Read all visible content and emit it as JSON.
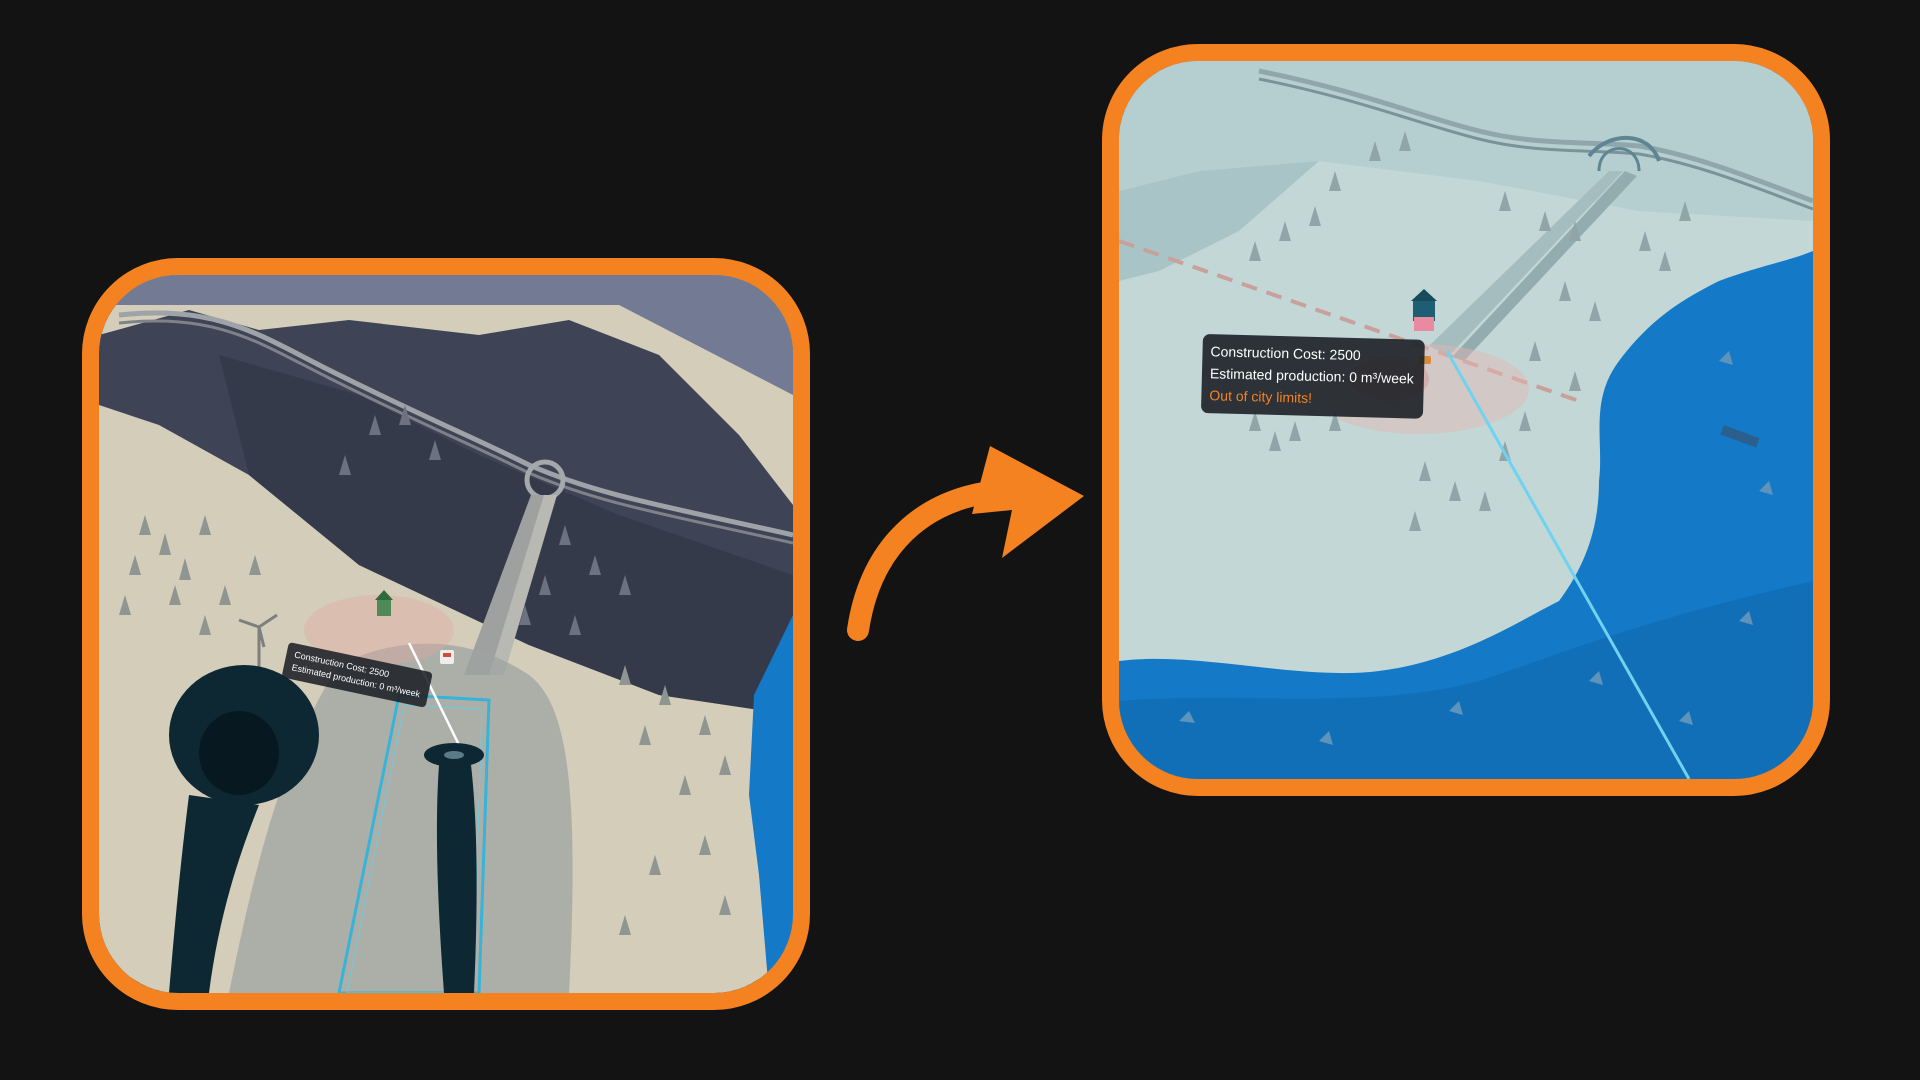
{
  "before": {
    "tooltip": {
      "cost_label": "Construction Cost: 2500",
      "production_label": "Estimated production: 0 m³/week"
    }
  },
  "after": {
    "tooltip": {
      "cost_label": "Construction Cost: 2500",
      "production_label": "Estimated production: 0 m³/week",
      "warning_label": "Out of city limits!"
    }
  },
  "colors": {
    "frame_accent": "#F58220",
    "background": "#131314",
    "water": "#1479C6",
    "snow": "#C2D7D6",
    "sand": "#D3CDBA",
    "mountain": "#3E4456",
    "warning_text": "#F58220"
  },
  "icons": {
    "transition": "curved-arrow-icon",
    "left_controller": "vr-controller-icon",
    "right_controller": "vr-controller-icon",
    "building": "building-icon",
    "marker": "map-marker-icon"
  }
}
